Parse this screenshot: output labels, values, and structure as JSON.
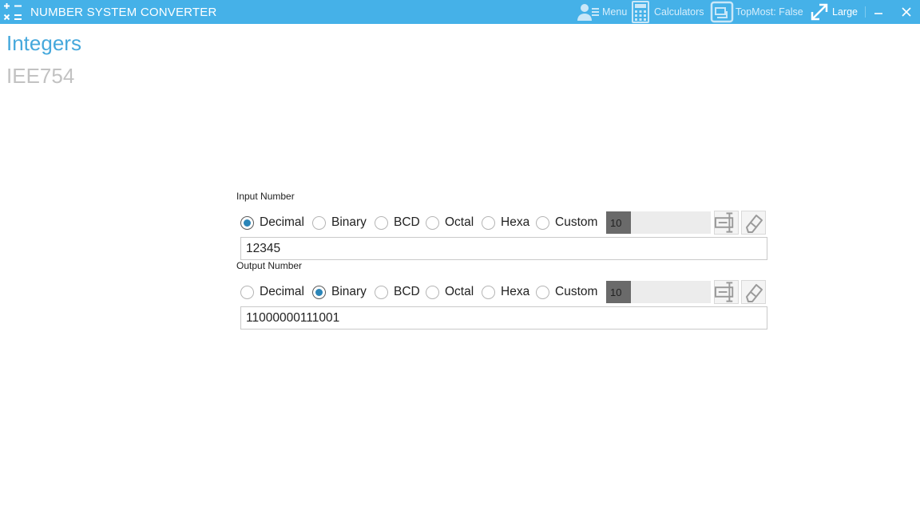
{
  "titlebar": {
    "title": "NUMBER SYSTEM CONVERTER",
    "icon": "calculator-grid-icon",
    "menu_label": "Menu",
    "calculators_label": "Calculators",
    "topmost_label": "TopMost: False",
    "size_label": "Large",
    "minimize_icon": "minimize-icon",
    "close_icon": "close-icon"
  },
  "nav": {
    "items": [
      {
        "label": "Integers",
        "active": true
      },
      {
        "label": "IEE754",
        "active": false
      }
    ]
  },
  "input": {
    "label": "Input Number",
    "options": [
      "Decimal",
      "Binary",
      "BCD",
      "Octal",
      "Hexa",
      "Custom"
    ],
    "selected": "Decimal",
    "custom_base": "10",
    "value": "12345"
  },
  "output": {
    "label": "Output Number",
    "options": [
      "Decimal",
      "Binary",
      "BCD",
      "Octal",
      "Hexa",
      "Custom"
    ],
    "selected": "Binary",
    "custom_base": "10",
    "value": "11000000111001"
  },
  "colors": {
    "accent": "#45b1e8",
    "nav_active": "#45a8dc",
    "nav_inactive": "#c2c2c2",
    "radio_dot": "#2a85b8"
  }
}
